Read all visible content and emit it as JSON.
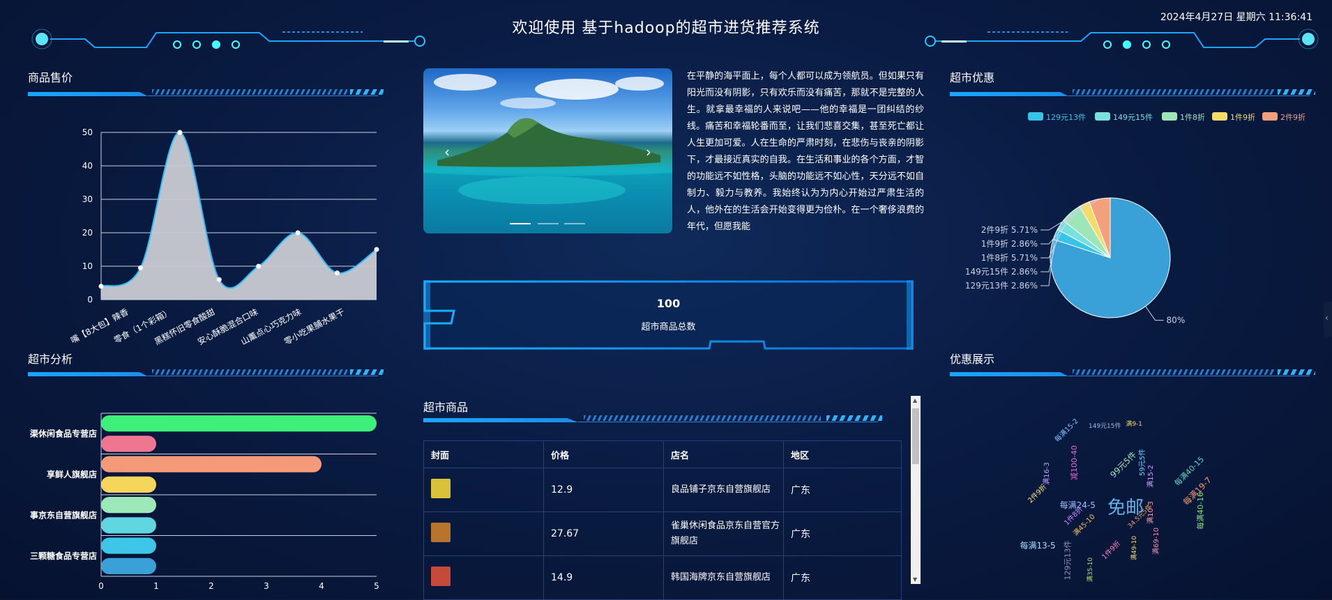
{
  "header": {
    "title": "欢迎使用 基于hadoop的超市进货推荐系统",
    "datetime": "2024年4月27日 星期六 11:36:41"
  },
  "panels": {
    "price": {
      "title": "商品售价"
    },
    "analysis": {
      "title": "超市分析"
    },
    "discount": {
      "title": "超市优惠"
    },
    "showcase": {
      "title": "优惠展示"
    },
    "goods": {
      "title": "超市商品"
    }
  },
  "carousel": {
    "prev_icon": "chevron-left-icon",
    "next_icon": "chevron-right-icon",
    "indicator_count": 3,
    "active_index": 0
  },
  "article": {
    "text": "在平静的海平面上，每个人都可以成为领航员。但如果只有阳光而没有阴影，只有欢乐而没有痛苦，那就不是完整的人生。就拿最幸福的人来说吧——他的幸福是一团纠结的纱线。痛苦和幸福轮番而至，让我们悲喜交集，甚至死亡都让人生更加可爱。人在生命的严肃时刻，在悲伤与丧亲的阴影下，才最接近真实的自我。在生活和事业的各个方面，才智的功能远不如性格，头脑的功能远不如心性，天分远不如自制力、毅力与教养。我始终认为为内心开始过严肃生活的人，他外在的生活会开始变得更为俭朴。在一个奢侈浪费的年代，但愿我能"
  },
  "stat": {
    "value": "100",
    "label": "超市商品总数"
  },
  "goods_table": {
    "headers": [
      "封面",
      "价格",
      "店名",
      "地区"
    ],
    "rows": [
      {
        "price": "12.9",
        "shop": "良品铺子京东自营旗舰店",
        "region": "广东",
        "thumb_color": "#d9c13a"
      },
      {
        "price": "27.67",
        "shop": "雀巢休闲食品京东自营官方旗舰店",
        "region": "广东",
        "thumb_color": "#b8742a"
      },
      {
        "price": "14.9",
        "shop": "韩国海牌京东自营旗舰店",
        "region": "广东",
        "thumb_color": "#c64a3a"
      }
    ]
  },
  "chart_data": [
    {
      "type": "area",
      "categories": [
        "嘴【8大包】辣香",
        "零食（1个彩箱）",
        "黑糕怀旧零食酸甜",
        "安心酥脆混合口味",
        "山薰点心巧克力味",
        "零小吃果脯水果干"
      ],
      "x": [
        0,
        1,
        2,
        3,
        4,
        5,
        6,
        7,
        8,
        9
      ],
      "values": [
        4,
        9.5,
        50,
        6,
        10,
        20,
        8,
        15
      ],
      "ylim": [
        0,
        50
      ],
      "yticks": [
        0,
        10,
        20,
        30,
        40,
        50
      ],
      "grid": true,
      "colors": {
        "fill": "#c9cbd2",
        "line": "#27c0ff"
      }
    },
    {
      "type": "bar",
      "orientation": "horizontal",
      "categories": [
        "三颗糖食品专营店",
        "",
        "事京东自营旗舰店",
        "",
        "享鲜人旗舰店",
        "",
        "渠休闲食品专营店",
        ""
      ],
      "values": [
        1,
        1,
        1,
        1,
        1,
        4,
        1,
        5
      ],
      "bar_colors": [
        "#3aa0d8",
        "#3ec6e8",
        "#5fd6e0",
        "#9de8b8",
        "#f5d65a",
        "#f59a78",
        "#ef7691",
        "#3ef07a"
      ],
      "xlim": [
        0,
        5
      ],
      "xticks": [
        0,
        1,
        2,
        3,
        4,
        5
      ]
    },
    {
      "type": "pie",
      "legend": [
        {
          "name": "129元13件",
          "color": "#36c4e8"
        },
        {
          "name": "149元15件",
          "color": "#79e0e0"
        },
        {
          "name": "1件8折",
          "color": "#9ee6b8"
        },
        {
          "name": "1件9折",
          "color": "#f5dc68"
        },
        {
          "name": "2件9折",
          "color": "#f5a07c"
        }
      ],
      "slices": [
        {
          "name": "",
          "value": 80,
          "label": "80%",
          "color": "#3aa0d8"
        },
        {
          "name": "129元13件",
          "value": 2.86,
          "label": "129元13件 2.86%",
          "color": "#36c4e8"
        },
        {
          "name": "149元15件",
          "value": 2.86,
          "label": "149元15件 2.86%",
          "color": "#79e0e0"
        },
        {
          "name": "1件8折",
          "value": 5.71,
          "label": "1件8折 5.71%",
          "color": "#9ee6b8"
        },
        {
          "name": "1件9折",
          "value": 2.86,
          "label": "1件9折 2.86%",
          "color": "#f5dc68"
        },
        {
          "name": "2件9折",
          "value": 5.71,
          "label": "2件9折 5.71%",
          "color": "#f5a07c"
        }
      ],
      "legend_position": "top"
    }
  ],
  "wordcloud": [
    {
      "t": "免邮",
      "c": "#5fb2e6"
    },
    {
      "t": "满45-10",
      "c": "#f0c060"
    },
    {
      "t": "99元5件",
      "c": "#9ee6b8"
    },
    {
      "t": "满69-10",
      "c": "#ef8fb0"
    },
    {
      "t": "2件9折",
      "c": "#f5e37a"
    },
    {
      "t": "每满40-15",
      "c": "#5fd6c0"
    },
    {
      "t": "满35-10",
      "c": "#aee07a"
    },
    {
      "t": "每满15-2",
      "c": "#79c0ff"
    },
    {
      "t": "满10-3",
      "c": "#ff9f9f"
    },
    {
      "t": "1件8折",
      "c": "#c88bff"
    },
    {
      "t": "59元5件",
      "c": "#6fd0ff"
    },
    {
      "t": "满49-10",
      "c": "#ffd86a"
    },
    {
      "t": "满16-3",
      "c": "#c0a0ff"
    },
    {
      "t": "每满19-7",
      "c": "#f09a70"
    },
    {
      "t": "129元13件",
      "c": "#9090c0"
    },
    {
      "t": "149元15件",
      "c": "#a0b8e0"
    },
    {
      "t": "34.5元5件",
      "c": "#f0a060"
    },
    {
      "t": "每满24-5",
      "c": "#9ec0ff"
    },
    {
      "t": "满15-2",
      "c": "#d0a0ff"
    },
    {
      "t": "1件9折",
      "c": "#ff7fbf"
    },
    {
      "t": "减100-40",
      "c": "#e06ad0"
    },
    {
      "t": "每满40-16",
      "c": "#7fe07f"
    },
    {
      "t": "每满13-5",
      "c": "#a0e0ff"
    },
    {
      "t": "满9-1",
      "c": "#f5d65a"
    }
  ]
}
